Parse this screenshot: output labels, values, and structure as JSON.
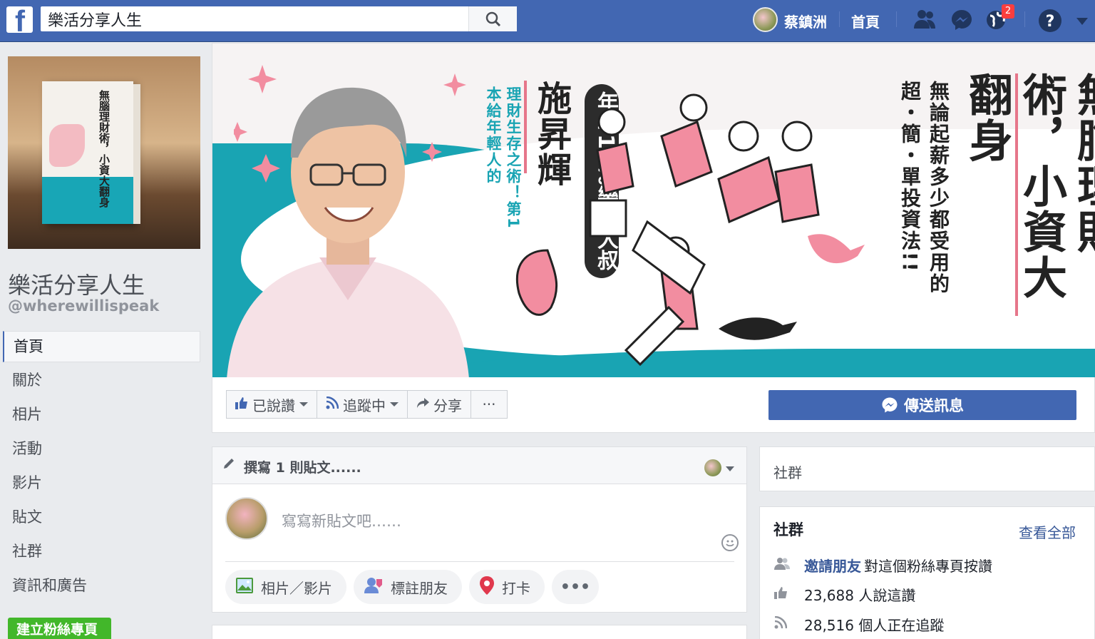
{
  "topbar": {
    "logo": "f",
    "search_value": "樂活分享人生",
    "user_name": "蔡鎮洲",
    "home_label": "首頁",
    "notification_count": "2",
    "icons": [
      "search-icon",
      "friends-icon",
      "messenger-icon",
      "globe-icon",
      "help-icon",
      "chevron-down-icon"
    ]
  },
  "page": {
    "name": "樂活分享人生",
    "handle": "@wherewillispeak"
  },
  "nav": {
    "items": [
      "首頁",
      "關於",
      "相片",
      "活動",
      "影片",
      "貼文",
      "社群",
      "資訊和廣告"
    ],
    "create_page": "建立粉絲專頁"
  },
  "cover": {
    "main_title": "無腦理財術，",
    "main_title2": "小資大翻身",
    "subtitle": "無論起薪多少都受用的",
    "subtitle2": "超・簡・單投資法!!",
    "author": "施昇輝",
    "tag": "年年18%樂活大叔",
    "tagline": "第1本給年輕人的",
    "tagline2": "理財生存之術！"
  },
  "actions": {
    "liked": "已說讚",
    "following": "追蹤中",
    "share": "分享",
    "more": "···",
    "message": "傳送訊息"
  },
  "composer": {
    "header": "撰寫 1 則貼文......",
    "placeholder": "寫寫新貼文吧……",
    "buttons": [
      "相片／影片",
      "標註朋友",
      "打卡"
    ],
    "more": "•••"
  },
  "right": {
    "box1_title": "社群",
    "box2_title": "社群",
    "see_all": "查看全部",
    "invite_link": "邀請朋友",
    "invite_text": "對這個粉絲專頁按讚",
    "likes": "23,688 人說這讚",
    "follows": "28,516 個人正在追蹤"
  },
  "colors": {
    "brand": "#4267b2",
    "link": "#385898",
    "green": "#42b72a",
    "teal": "#19a4b3",
    "pink": "#e6768a"
  }
}
